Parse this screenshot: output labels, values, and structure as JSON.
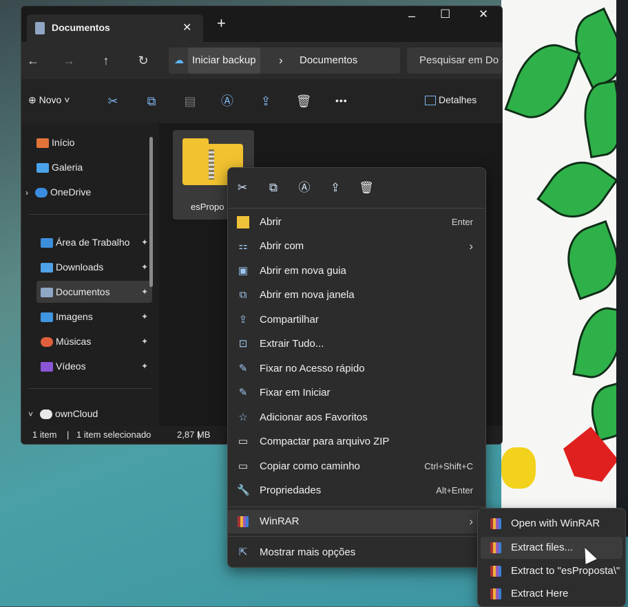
{
  "window": {
    "tab_title": "Documentos",
    "new_tab": "+",
    "controls": {
      "minimize": "–",
      "maximize": "☐",
      "close": "✕"
    },
    "tab_close": "✕"
  },
  "nav": {
    "back": "←",
    "forward": "→",
    "up": "↑",
    "refresh": "↻",
    "breadcrumb_root": "Iniciar backup",
    "breadcrumb_sep": "›",
    "breadcrumb_current": "Documentos",
    "search_placeholder": "Pesquisar em Do"
  },
  "toolbar": {
    "new_label": "Novo",
    "more": "•••",
    "details_label": "Detalhes"
  },
  "sidebar": {
    "items": [
      {
        "label": "Início",
        "color": "#e2743a",
        "pinned": false
      },
      {
        "label": "Galeria",
        "color": "#4aa3e8",
        "pinned": false
      },
      {
        "label": "OneDrive",
        "color": "#3b8de0",
        "pinned": false
      },
      {
        "label": "Área de Trabalho",
        "color": "#3c8fdc",
        "pinned": true
      },
      {
        "label": "Downloads",
        "color": "#4ea1e6",
        "pinned": true
      },
      {
        "label": "Documentos",
        "color": "#8fa7c4",
        "pinned": true
      },
      {
        "label": "Imagens",
        "color": "#3f95e0",
        "pinned": true
      },
      {
        "label": "Músicas",
        "color": "#e0603c",
        "pinned": true
      },
      {
        "label": "Vídeos",
        "color": "#8a56d6",
        "pinned": true
      },
      {
        "label": "ownCloud",
        "color": "#e8e8e8",
        "pinned": false
      }
    ],
    "pin_glyph": "📌"
  },
  "content": {
    "file_name": "esPropo"
  },
  "status": {
    "count": "1 item",
    "selected": "1 item selecionado",
    "size": "2,87 MB"
  },
  "context_menu": {
    "items": [
      {
        "icon": "folder-open-icon",
        "label": "Abrir",
        "shortcut": "Enter"
      },
      {
        "icon": "open-with-icon",
        "label": "Abrir com",
        "shortcut": "›"
      },
      {
        "icon": "new-tab-icon",
        "label": "Abrir em nova guia",
        "shortcut": ""
      },
      {
        "icon": "new-window-icon",
        "label": "Abrir em nova janela",
        "shortcut": ""
      },
      {
        "icon": "share-icon",
        "label": "Compartilhar",
        "shortcut": ""
      },
      {
        "icon": "extract-icon",
        "label": "Extrair Tudo...",
        "shortcut": ""
      },
      {
        "icon": "pin-icon",
        "label": "Fixar no Acesso rápido",
        "shortcut": ""
      },
      {
        "icon": "pin-start-icon",
        "label": "Fixar em Iniciar",
        "shortcut": ""
      },
      {
        "icon": "star-icon",
        "label": "Adicionar aos Favoritos",
        "shortcut": ""
      },
      {
        "icon": "zip-icon",
        "label": "Compactar para arquivo ZIP",
        "shortcut": ""
      },
      {
        "icon": "copy-path-icon",
        "label": "Copiar como caminho",
        "shortcut": "Ctrl+Shift+C"
      },
      {
        "icon": "wrench-icon",
        "label": "Propriedades",
        "shortcut": "Alt+Enter"
      }
    ],
    "winrar_label": "WinRAR",
    "winrar_arrow": "›",
    "more_options": "Mostrar mais opções"
  },
  "winrar_submenu": {
    "items": [
      {
        "label": "Open with WinRAR"
      },
      {
        "label": "Extract files..."
      },
      {
        "label": "Extract to \"esProposta\\\""
      },
      {
        "label": "Extract Here"
      }
    ]
  }
}
